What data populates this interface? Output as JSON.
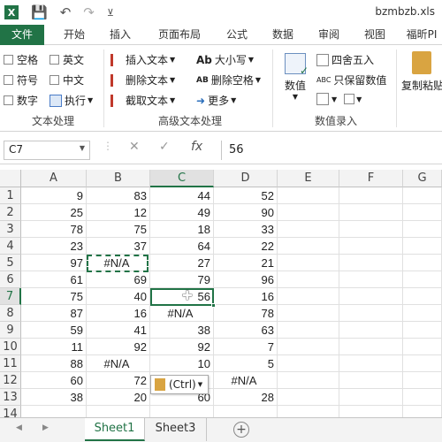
{
  "app": {
    "title": "bzmbzb.xls"
  },
  "quick_access": {
    "save": "save-icon",
    "undo": "undo-icon",
    "redo": "redo-icon",
    "pin": "pin-icon"
  },
  "tabs": [
    "文件",
    "开始",
    "插入",
    "页面布局",
    "公式",
    "数据",
    "审阅",
    "视图",
    "福昕PI"
  ],
  "ribbon": {
    "group1": {
      "label": "文本处理",
      "items": [
        "空格",
        "英文",
        "符号",
        "中文",
        "数字",
        "执行"
      ]
    },
    "group2": {
      "label": "高级文本处理",
      "items": [
        "插入文本",
        "大小写",
        "删除文本",
        "删除空格",
        "截取文本",
        "更多"
      ]
    },
    "group3": {
      "label": "数值录入",
      "numeric": "数值",
      "round": "四舍五入",
      "keep_values": "只保留数值"
    },
    "group4": {
      "paste": "复制粘贴"
    }
  },
  "formula_bar": {
    "name_box": "C7",
    "value": "56",
    "cancel": "✕",
    "enter": "✓",
    "fx": "fx"
  },
  "columns": [
    "A",
    "B",
    "C",
    "D",
    "E",
    "F",
    "G"
  ],
  "rows": [
    "1",
    "2",
    "3",
    "4",
    "5",
    "6",
    "7",
    "8",
    "9",
    "10",
    "11",
    "12",
    "13",
    "14"
  ],
  "cells": [
    [
      "9",
      "83",
      "44",
      "52"
    ],
    [
      "25",
      "12",
      "49",
      "90"
    ],
    [
      "78",
      "75",
      "18",
      "33"
    ],
    [
      "23",
      "37",
      "64",
      "22"
    ],
    [
      "97",
      "#N/A",
      "27",
      "21"
    ],
    [
      "61",
      "69",
      "79",
      "96"
    ],
    [
      "75",
      "40",
      "56",
      "16"
    ],
    [
      "87",
      "16",
      "#N/A",
      "78"
    ],
    [
      "59",
      "41",
      "38",
      "63"
    ],
    [
      "11",
      "92",
      "92",
      "7"
    ],
    [
      "88",
      "#N/A",
      "10",
      "5"
    ],
    [
      "60",
      "72",
      "",
      "#N/A"
    ],
    [
      "38",
      "20",
      "60",
      "28"
    ],
    [
      "",
      "",
      "",
      ""
    ]
  ],
  "paste_options": {
    "label": "(Ctrl)"
  },
  "sheets": [
    "Sheet1",
    "Sheet3"
  ],
  "colors": {
    "accent": "#217346"
  }
}
